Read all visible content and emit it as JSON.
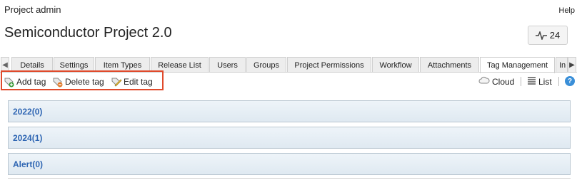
{
  "header": {
    "section": "Project admin",
    "help": "Help",
    "project_title": "Semiconductor Project 2.0",
    "activity_count": "24"
  },
  "tabs": [
    {
      "label": "Details"
    },
    {
      "label": "Settings"
    },
    {
      "label": "Item Types"
    },
    {
      "label": "Release List"
    },
    {
      "label": "Users"
    },
    {
      "label": "Groups"
    },
    {
      "label": "Project Permissions"
    },
    {
      "label": "Workflow"
    },
    {
      "label": "Attachments"
    },
    {
      "label": "Tag Management",
      "active": true
    },
    {
      "label": "In"
    }
  ],
  "toolbar": {
    "add": "Add tag",
    "delete": "Delete tag",
    "edit": "Edit tag",
    "cloud": "Cloud",
    "list": "List",
    "help_glyph": "?"
  },
  "groups": [
    {
      "label": "2022(0)"
    },
    {
      "label": "2024(1)"
    },
    {
      "label": "Alert(0)"
    }
  ],
  "colors": {
    "highlight_border": "#e04a2c",
    "link_blue": "#2f66b3"
  }
}
